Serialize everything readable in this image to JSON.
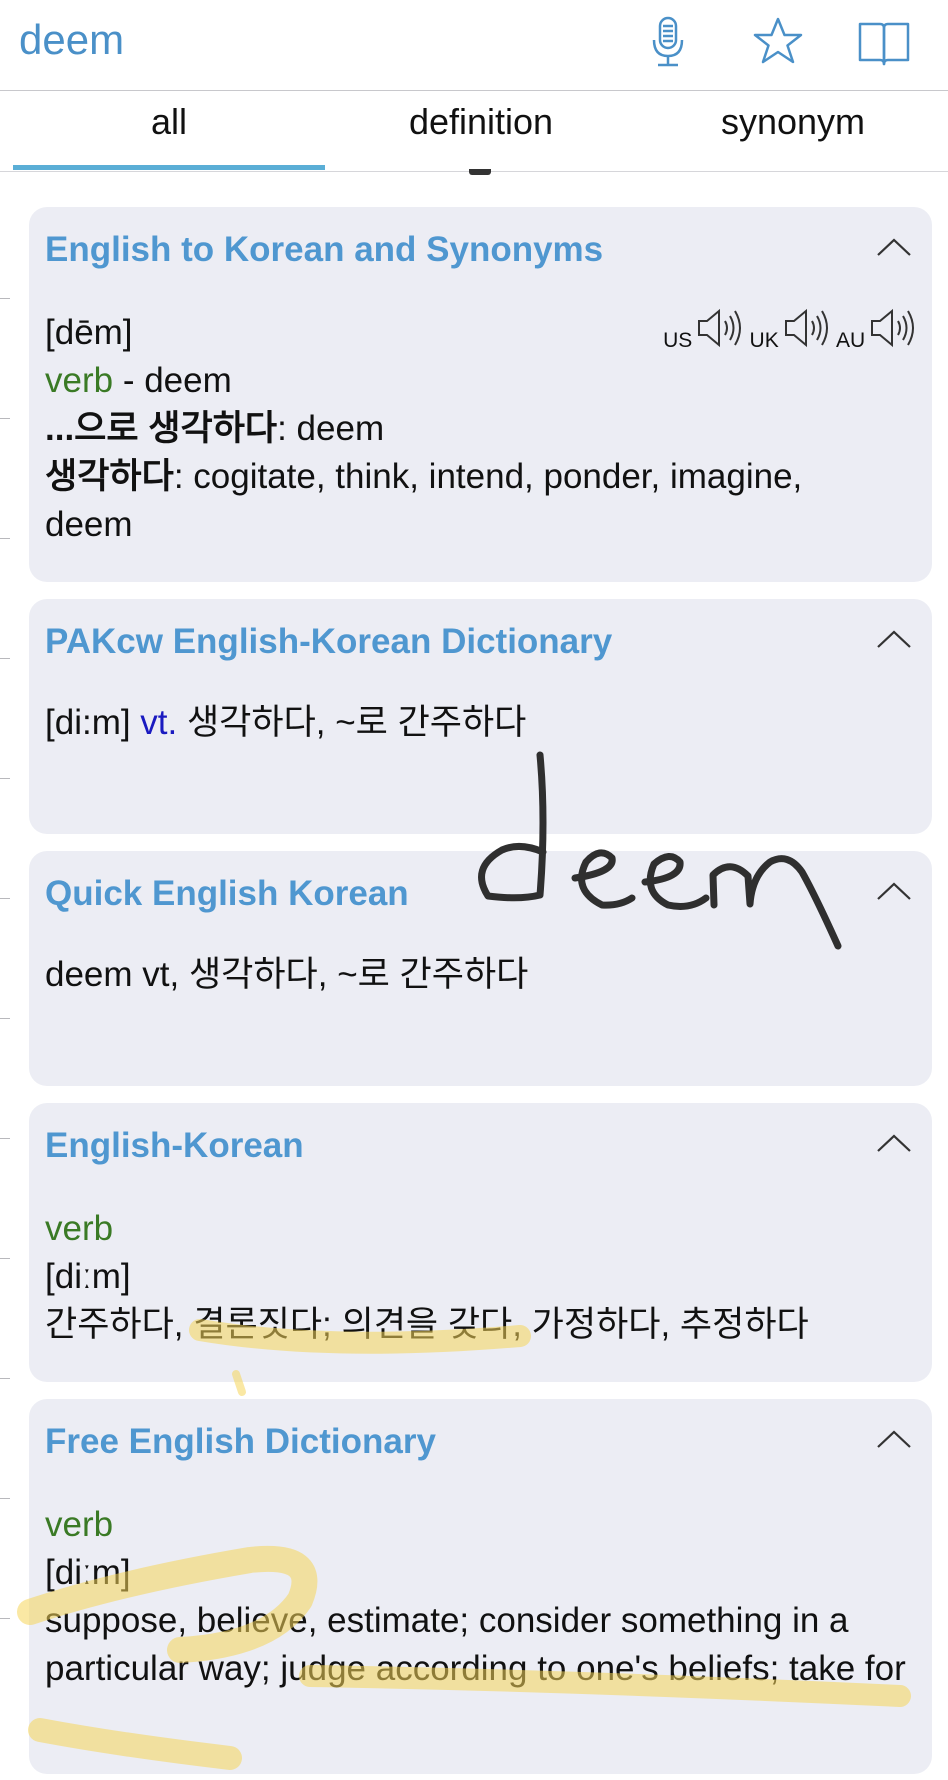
{
  "header": {
    "search_term": "deem",
    "icons": [
      "microphone-icon",
      "star-icon",
      "book-icon"
    ]
  },
  "tabs": [
    {
      "label": "all",
      "active": true
    },
    {
      "label": "definition",
      "active": false
    },
    {
      "label": "synonym",
      "active": false
    }
  ],
  "cards": {
    "c1": {
      "title": "English to Korean and Synonyms",
      "pron": "[dēm]",
      "pos": "verb",
      "pos_rest": " - deem",
      "kw1": "...으로 생각하다",
      "kw1_rest": ": deem",
      "kw2": "생각하다",
      "kw2_rest": ": cogitate, think, intend, ponder, imagine, deem",
      "audio": [
        "US",
        "UK",
        "AU"
      ]
    },
    "c2": {
      "title": "PAKcw English-Korean Dictionary",
      "pron": "[di:m] ",
      "pos": "vt.",
      "def": " 생각하다, ~로 간주하다"
    },
    "c3": {
      "title": "Quick English Korean",
      "def": "deem vt, 생각하다, ~로 간주하다"
    },
    "c4": {
      "title": "English-Korean",
      "pos": "verb",
      "pron": "[diːm]",
      "def": "간주하다, 결론짓다; 의견을 갖다, 가정하다, 추정하다"
    },
    "c5": {
      "title": "Free English Dictionary",
      "pos": "verb",
      "pron": "[diːm]",
      "def": "suppose, believe, estimate; consider something in a particular way; judge according to one's beliefs; take for"
    }
  },
  "annotations": {
    "handwriting": "deem"
  },
  "colors": {
    "accent": "#4f97d0",
    "pos_green": "#3a7a25",
    "card_bg": "#ecedf4",
    "highlight": "#f6d65a"
  }
}
